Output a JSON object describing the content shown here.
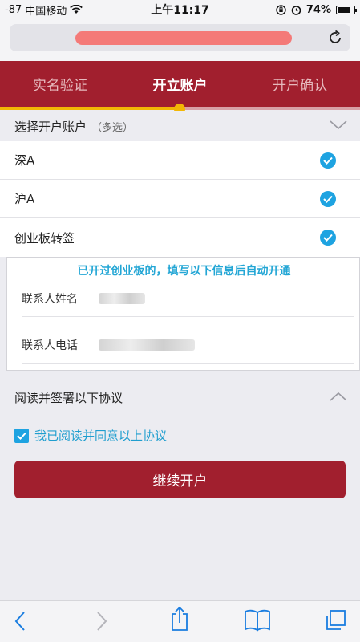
{
  "status_bar": {
    "signal": "-87",
    "carrier": "中国移动",
    "time": "上午11:17",
    "battery_percent": "74%",
    "battery_level": 0.74
  },
  "browser": {
    "url_redacted": true,
    "reload_icon": "reload-icon"
  },
  "steps": [
    {
      "label": "实名验证",
      "active": false
    },
    {
      "label": "开立账户",
      "active": true
    },
    {
      "label": "开户确认",
      "active": false
    }
  ],
  "accounts_section": {
    "title": "选择开户账户",
    "hint": "（多选）",
    "items": [
      {
        "label": "深A",
        "checked": true
      },
      {
        "label": "沪A",
        "checked": true
      },
      {
        "label": "创业板转签",
        "checked": true
      }
    ]
  },
  "contact": {
    "notice": "已开过创业板的，填写以下信息后自动开通",
    "name_label": "联系人姓名",
    "phone_label": "联系人电话"
  },
  "agreement_section": {
    "title": "阅读并签署以下协议",
    "agree_label": "我已阅读并同意以上协议",
    "checked": true
  },
  "continue_button": "继续开户",
  "colors": {
    "brand_red": "#a11f2e",
    "accent_blue": "#1ea3e1",
    "progress_yellow": "#f2b705"
  }
}
